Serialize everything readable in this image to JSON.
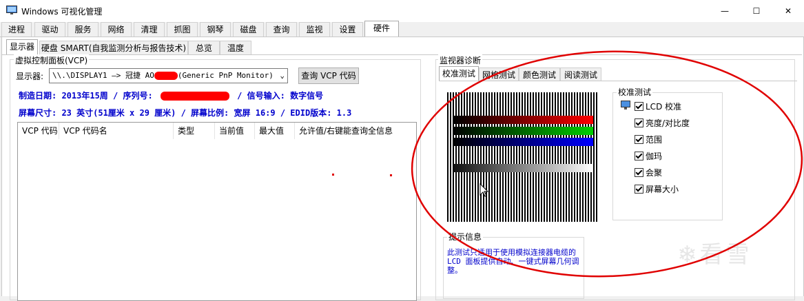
{
  "window": {
    "title": "Windows 可视化管理",
    "minimize": "—",
    "maximize": "☐",
    "close": "✕"
  },
  "main_tabs": [
    "进程",
    "驱动",
    "服务",
    "网络",
    "清理",
    "抓图",
    "钢琴",
    "磁盘",
    "查询",
    "监视",
    "设置",
    "硬件"
  ],
  "main_tabs_active": "硬件",
  "sub_tabs": [
    "显示器",
    "硬盘 SMART(自我监测分析与报告技术)",
    "总览",
    "温度"
  ],
  "sub_tabs_active": "显示器",
  "vcp": {
    "group_label": "虚拟控制面板(VCP)",
    "display_label": "显示器:",
    "display_value_prefix": "\\\\.\\DISPLAY1 —> 冠捷 AO",
    "display_value_suffix": "(Generic PnP Monitor)",
    "query_button": "查询 VCP 代码",
    "info_line1_a": "制造日期: 2013年15周  /  序列号:",
    "info_line1_b": "/  信号输入: 数字信号",
    "info_line2": "屏幕尺寸: 23 英寸(51厘米 x 29 厘米)  /  屏幕比例: 宽屏 16:9  /  EDID版本: 1.3",
    "columns": [
      "VCP 代码",
      "VCP 代码名",
      "类型",
      "当前值",
      "最大值",
      "允许值/右键能查询全信息"
    ]
  },
  "diagnostics": {
    "group_label": "监视器诊断",
    "tabs": [
      "校准测试",
      "网格测试",
      "颜色测试",
      "阅读测试"
    ],
    "tabs_active": "校准测试",
    "calib_group_label": "校准测试",
    "options": [
      "LCD 校准",
      "亮度/对比度",
      "范围",
      "伽玛",
      "会聚",
      "屏幕大小"
    ],
    "tip_group_label": "提示信息",
    "tip_text": "此测试只适用于使用模拟连接器电缆的 LCD 面板提供自动、一键式屏幕几何调整。"
  },
  "watermark": "看雪",
  "colors": {
    "bar_red": "#ff0000",
    "bar_green": "#00c000",
    "bar_blue": "#0000ff",
    "annotation": "#e00000",
    "info_text": "#0000cc"
  }
}
